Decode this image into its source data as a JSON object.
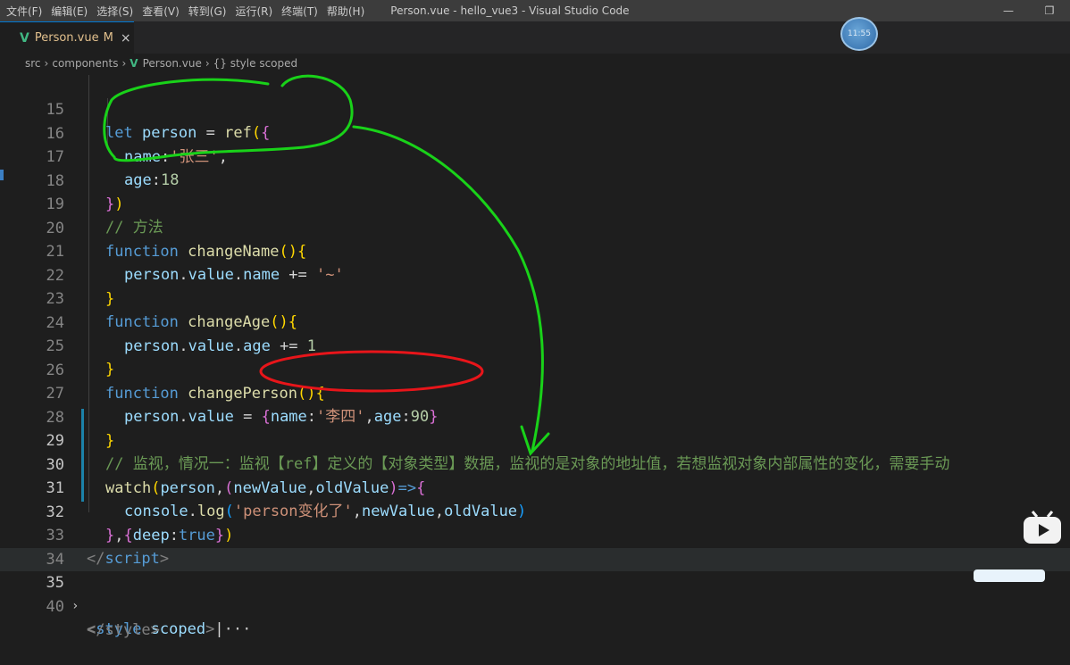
{
  "menu": [
    "文件(F)",
    "编辑(E)",
    "选择(S)",
    "查看(V)",
    "转到(G)",
    "运行(R)",
    "终端(T)",
    "帮助(H)"
  ],
  "window_title": "Person.vue - hello_vue3 - Visual Studio Code",
  "window_controls": {
    "minimize": "—",
    "restore": "❐"
  },
  "tab": {
    "label": "Person.vue",
    "status": "M",
    "close": "×",
    "icon": "vue-icon"
  },
  "overlay_clock": "11:55",
  "editor_actions": [
    "history-icon",
    "compare-changes-icon",
    "split-editor-icon"
  ],
  "breadcrumb": {
    "items": [
      "src",
      "components",
      "Person.vue",
      "{} style scoped"
    ]
  },
  "line_numbers": [
    "15",
    "16",
    "17",
    "18",
    "19",
    "20",
    "21",
    "22",
    "23",
    "24",
    "25",
    "26",
    "27",
    "28",
    "29",
    "30",
    "31",
    "32",
    "33",
    "34",
    "35",
    "40"
  ],
  "code": {
    "l15": {
      "kw": "let",
      "name": "person",
      "eq": " = ",
      "fn": "ref",
      "open": "(",
      "brace": "{"
    },
    "l16": {
      "key": "name",
      "colon": ":",
      "val": "'张三'",
      "comma": ","
    },
    "l17": {
      "key": "age",
      "colon": ":",
      "val": "18"
    },
    "l18": {
      "brace": "}",
      "close": ")"
    },
    "l19": {
      "comment": "// 方法"
    },
    "l20": {
      "kw": "function",
      "name": "changeName",
      "paren": "()",
      "brace": "{"
    },
    "l21": {
      "obj": "person",
      "p1": ".",
      "prop1": "value",
      "p2": ".",
      "prop2": "name",
      "op": " += ",
      "str": "'~'"
    },
    "l22": {
      "brace": "}"
    },
    "l23": {
      "kw": "function",
      "name": "changeAge",
      "paren": "()",
      "brace": "{"
    },
    "l24": {
      "obj": "person",
      "p1": ".",
      "prop1": "value",
      "p2": ".",
      "prop2": "age",
      "op": " += ",
      "num": "1"
    },
    "l25": {
      "brace": "}"
    },
    "l26": {
      "kw": "function",
      "name": "changePerson",
      "paren": "()",
      "brace": "{"
    },
    "l27": {
      "obj": "person",
      "p1": ".",
      "prop1": "value",
      "op": " = ",
      "b1": "{",
      "k1": "name",
      "c1": ":",
      "v1": "'李四'",
      "cm": ",",
      "k2": "age",
      "c2": ":",
      "v2": "90",
      "b2": "}"
    },
    "l28": {
      "brace": "}"
    },
    "l29": {
      "comment": "// 监视，情况一：监视【ref】定义的【对象类型】数据，监视的是对象的地址值，若想监视对象内部属性的变化，需要手动"
    },
    "l30": {
      "fn": "watch",
      "open": "(",
      "a1": "person",
      "c1": ",",
      "p1": "(",
      "a2": "newValue",
      "c2": ",",
      "a3": "oldValue",
      "p2": ")",
      "arrow": "=>",
      "brace": "{"
    },
    "l31": {
      "obj": "console",
      "dot": ".",
      "fn": "log",
      "open": "(",
      "str": "'person变化了'",
      "c1": ",",
      "a1": "newValue",
      "c2": ",",
      "a2": "oldValue",
      "close": ")"
    },
    "l32": {
      "b1": "}",
      "c": ",",
      "b2": "{",
      "key": "deep",
      "colon": ":",
      "val": "true",
      "b3": "}",
      "close": ")"
    },
    "l33": {
      "lt": "</",
      "tag": "script",
      "gt": ">"
    },
    "l35": {
      "lt": "<",
      "tag": "style",
      "attr": "scoped",
      "gt": ">",
      "cursor": "|",
      "ell": "···"
    },
    "l40": {
      "text": "</style>"
    }
  },
  "annotation_colors": {
    "green": "#19d219",
    "red": "#e8151a"
  }
}
